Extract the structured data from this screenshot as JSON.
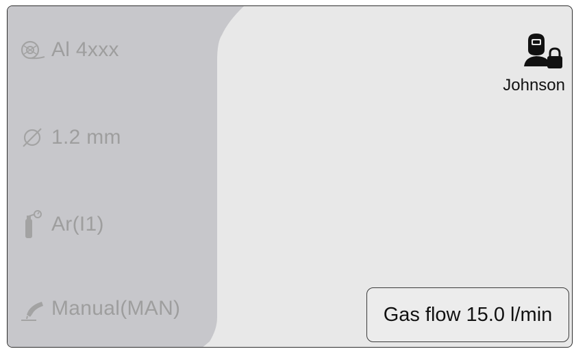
{
  "sidebar": {
    "items": [
      {
        "label": "Al 4xxx",
        "icon": "wire-spool-icon"
      },
      {
        "label": "1.2 mm",
        "icon": "diameter-icon"
      },
      {
        "label": "Ar(I1)",
        "icon": "gas-cylinder-icon"
      },
      {
        "label": "Manual(MAN)",
        "icon": "welding-torch-icon"
      }
    ]
  },
  "user": {
    "name": "Johnson",
    "icon": "welder-locked-icon"
  },
  "gas_flow": {
    "label": "Gas flow 15.0 l/min"
  },
  "colors": {
    "sidebar_bg": "#c7c7cb",
    "main_bg": "#e8e8e8",
    "muted_text": "#9e9e9e",
    "text": "#111111"
  }
}
